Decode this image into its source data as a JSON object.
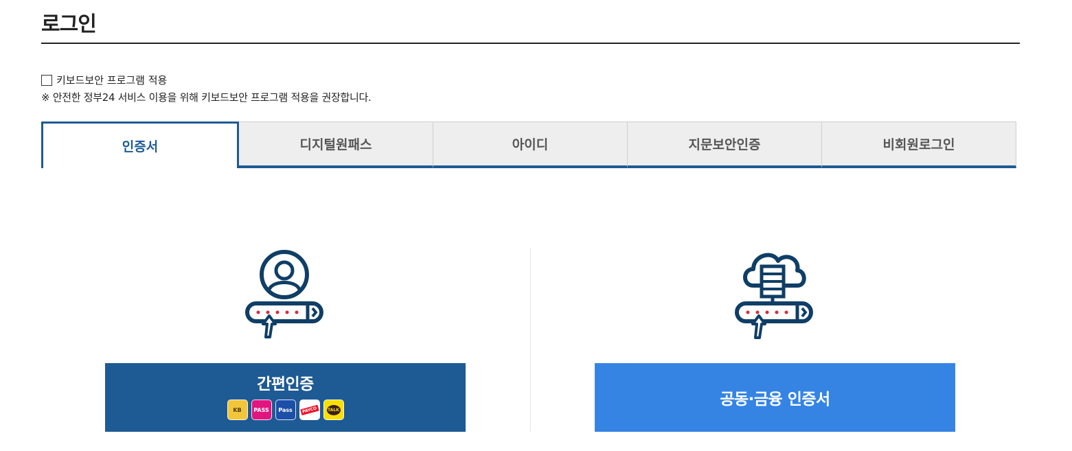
{
  "header": {
    "title": "로그인"
  },
  "keyboard_security": {
    "checkbox_label": "키보드보안 프로그램 적용",
    "checked": false,
    "note": "※ 안전한 정부24 서비스 이용을 위해 키보드보안 프로그램 적용을 권장합니다."
  },
  "tabs": [
    {
      "label": "인증서",
      "active": true
    },
    {
      "label": "디지털원패스",
      "active": false
    },
    {
      "label": "아이디",
      "active": false
    },
    {
      "label": "지문보안인증",
      "active": false
    },
    {
      "label": "비회원로그인",
      "active": false
    }
  ],
  "options": {
    "simple_auth": {
      "label": "간편인증",
      "icon": "person-password-icon",
      "providers": [
        {
          "name": "kb-icon",
          "text": "KB"
        },
        {
          "name": "pass-icon",
          "text": "PASS"
        },
        {
          "name": "samsung-pass-icon",
          "text": "Pass"
        },
        {
          "name": "payco-icon",
          "text": "PAYCO"
        },
        {
          "name": "kakao-talk-icon",
          "text": "TALK"
        }
      ]
    },
    "joint_cert": {
      "label": "공동·금융 인증서",
      "icon": "cloud-server-password-icon"
    }
  },
  "colors": {
    "primary_dark": "#1e5a94",
    "primary_light": "#3584e4",
    "accent_dot": "#d62b3b"
  }
}
